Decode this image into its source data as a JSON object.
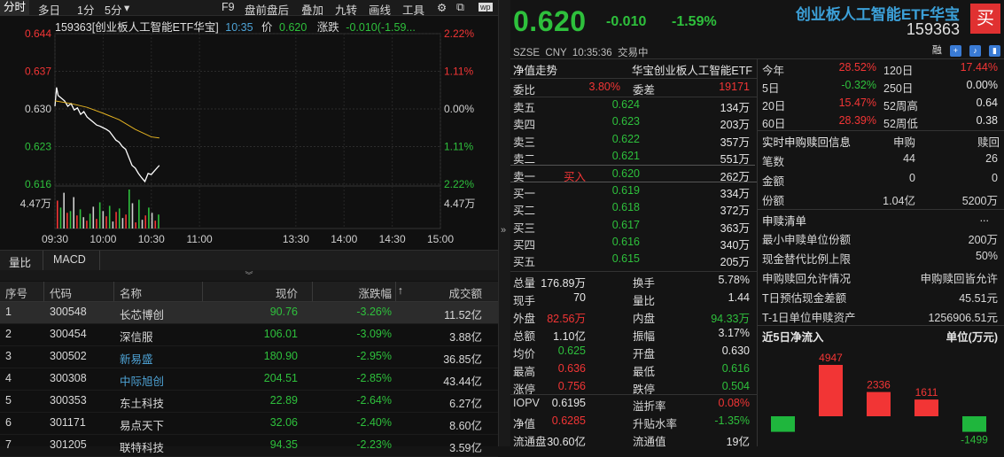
{
  "toolbar": {
    "items": [
      "分时",
      "多日",
      "1分",
      "5分",
      "F9",
      "盘前盘后",
      "叠加",
      "九转",
      "画线",
      "工具"
    ]
  },
  "chart_header": {
    "title": "159363[创业板人工智能ETF华宝]",
    "time": "10:35",
    "price_label": "价",
    "price": "0.620",
    "chg_label": "涨跌",
    "chg": "-0.010(-1.59..."
  },
  "y_left": [
    "0.644",
    "0.637",
    "0.630",
    "0.623",
    "0.616"
  ],
  "y_right": [
    "2.22%",
    "1.11%",
    "0.00%",
    "1.11%",
    "2.22%"
  ],
  "vol_label": "4.47万",
  "x_ticks": [
    "09:30",
    "10:00",
    "10:30",
    "11:00",
    "13:30",
    "14:00",
    "14:30",
    "15:00"
  ],
  "chart_data": {
    "type": "line",
    "x_range": [
      "09:30",
      "15:00"
    ],
    "ylim": [
      0.616,
      0.644
    ],
    "reference": 0.63,
    "series": [
      {
        "color": "#ffffff",
        "x": [
          "09:30",
          "09:31",
          "09:32",
          "09:34",
          "09:36",
          "09:38",
          "09:40",
          "09:42",
          "09:44",
          "09:46",
          "09:48",
          "09:50",
          "09:52",
          "09:54",
          "09:56",
          "09:58",
          "10:00",
          "10:02",
          "10:04",
          "10:06",
          "10:08",
          "10:10",
          "10:12",
          "10:14",
          "10:16",
          "10:18",
          "10:20",
          "10:22",
          "10:24",
          "10:26",
          "10:28",
          "10:30",
          "10:32",
          "10:35"
        ],
        "values": [
          0.6305,
          0.634,
          0.6325,
          0.632,
          0.6315,
          0.6305,
          0.631,
          0.6298,
          0.6302,
          0.629,
          0.6295,
          0.6285,
          0.628,
          0.6275,
          0.627,
          0.6268,
          0.6265,
          0.6262,
          0.6258,
          0.625,
          0.6242,
          0.6238,
          0.623,
          0.6225,
          0.621,
          0.6195,
          0.619,
          0.618,
          0.6172,
          0.6165,
          0.618,
          0.6178,
          0.6185,
          0.6195
        ]
      },
      {
        "color": "#e6b422",
        "x": [
          "09:30",
          "09:40",
          "09:50",
          "10:00",
          "10:10",
          "10:20",
          "10:30",
          "10:35"
        ],
        "values": [
          0.6315,
          0.631,
          0.6303,
          0.6292,
          0.628,
          0.6262,
          0.6248,
          0.6246
        ]
      }
    ],
    "volume": [
      3.2,
      2.4,
      4.1,
      1.8,
      2.0,
      3.6,
      1.5,
      2.2,
      1.3,
      0.9,
      1.7,
      2.5,
      1.1,
      3.0,
      2.0,
      1.4,
      2.6,
      0.8,
      1.9,
      2.3,
      1.2,
      1.6,
      4.47,
      2.9,
      0.7,
      3.3,
      1.0,
      1.5,
      2.4,
      1.8,
      0.9,
      1.6
    ]
  },
  "subbar": {
    "items": [
      "量比",
      "MACD"
    ]
  },
  "table": {
    "headers": [
      "序号",
      "代码",
      "名称",
      "现价",
      "涨跌幅",
      "成交额"
    ],
    "rows": [
      [
        "1",
        "300548",
        "长芯博创",
        "90.76",
        "-3.26%",
        "11.52亿"
      ],
      [
        "2",
        "300454",
        "深信服",
        "106.01",
        "-3.09%",
        "3.88亿"
      ],
      [
        "3",
        "300502",
        "新易盛",
        "180.90",
        "-2.95%",
        "36.85亿"
      ],
      [
        "4",
        "300308",
        "中际旭创",
        "204.51",
        "-2.85%",
        "43.44亿"
      ],
      [
        "5",
        "300353",
        "东土科技",
        "22.89",
        "-2.64%",
        "6.27亿"
      ],
      [
        "6",
        "301171",
        "易点天下",
        "32.06",
        "-2.40%",
        "8.60亿"
      ],
      [
        "7",
        "301205",
        "联特科技",
        "94.35",
        "-2.23%",
        "3.59亿"
      ]
    ]
  },
  "quote": {
    "price": "0.620",
    "chg": "-0.010",
    "chgpct": "-1.59%",
    "name": "创业板人工智能ETF华宝",
    "code": "159363",
    "buy_label": "买",
    "meta": "SZSE  CNY  10:35:36  交易中",
    "icon_rong": "融"
  },
  "nav": {
    "label": "净值走势",
    "name": "华宝创业板人工智能ETF"
  },
  "weibi": {
    "l1": "委比",
    "v1": "3.80%",
    "l2": "委差",
    "v2": "19171"
  },
  "asks": [
    {
      "label": "卖五",
      "price": "0.624",
      "vol": "134万"
    },
    {
      "label": "卖四",
      "price": "0.623",
      "vol": "203万"
    },
    {
      "label": "卖三",
      "price": "0.622",
      "vol": "357万"
    },
    {
      "label": "卖二",
      "price": "0.621",
      "vol": "551万"
    },
    {
      "label": "卖一",
      "mid": "买入",
      "price": "0.620",
      "vol": "262万"
    }
  ],
  "bids": [
    {
      "label": "买一",
      "price": "0.619",
      "vol": "334万"
    },
    {
      "label": "买二",
      "price": "0.618",
      "vol": "372万"
    },
    {
      "label": "买三",
      "price": "0.617",
      "vol": "363万"
    },
    {
      "label": "买四",
      "price": "0.616",
      "vol": "340万"
    },
    {
      "label": "买五",
      "price": "0.615",
      "vol": "205万"
    }
  ],
  "stats": [
    [
      "总量",
      "176.89万",
      "换手",
      "5.78%"
    ],
    [
      "现手",
      "70",
      "量比",
      "1.44"
    ],
    [
      "外盘",
      "82.56万",
      "内盘",
      "94.33万"
    ],
    [
      "总额",
      "1.10亿",
      "振幅",
      "3.17%"
    ],
    [
      "均价",
      "0.625",
      "开盘",
      "0.630"
    ],
    [
      "最高",
      "0.636",
      "最低",
      "0.616"
    ],
    [
      "涨停",
      "0.756",
      "跌停",
      "0.504"
    ]
  ],
  "stats2": [
    [
      "IOPV",
      "0.6195",
      "溢折率",
      "0.08%"
    ],
    [
      "净值",
      "0.6285",
      "升贴水率",
      "-1.35%"
    ],
    [
      "流通盘",
      "30.60亿",
      "流通值",
      "19亿"
    ]
  ],
  "perf": [
    [
      "今年",
      "28.52%",
      "120日",
      "17.44%"
    ],
    [
      "5日",
      "-0.32%",
      "250日",
      "0.00%"
    ],
    [
      "20日",
      "15.47%",
      "52周高",
      "0.64"
    ],
    [
      "60日",
      "28.39%",
      "52周低",
      "0.38"
    ]
  ],
  "redeem": {
    "title": "实时申购赎回信息",
    "col1": "申购",
    "col2": "赎回",
    "rows": [
      [
        "笔数",
        "44",
        "26"
      ],
      [
        "金额",
        "0",
        "0"
      ],
      [
        "份额",
        "1.04亿",
        "5200万"
      ]
    ]
  },
  "list": {
    "title": "申赎清单",
    "more": "...",
    "rows": [
      [
        "最小申赎单位份额",
        "200万"
      ],
      [
        "现金替代比例上限",
        "50%"
      ],
      [
        "申购赎回允许情况",
        "申购赎回皆允许"
      ],
      [
        "T日预估现金差额",
        "45.51元"
      ],
      [
        "T-1日单位申赎资产",
        "1256906.51元"
      ]
    ]
  },
  "flow": {
    "title": "近5日净流入",
    "unit": "单位(万元)",
    "values": [
      -1500,
      4947,
      2336,
      1611,
      -1499
    ],
    "labels": [
      "",
      "4947",
      "2336",
      "1611",
      "-1499"
    ]
  }
}
